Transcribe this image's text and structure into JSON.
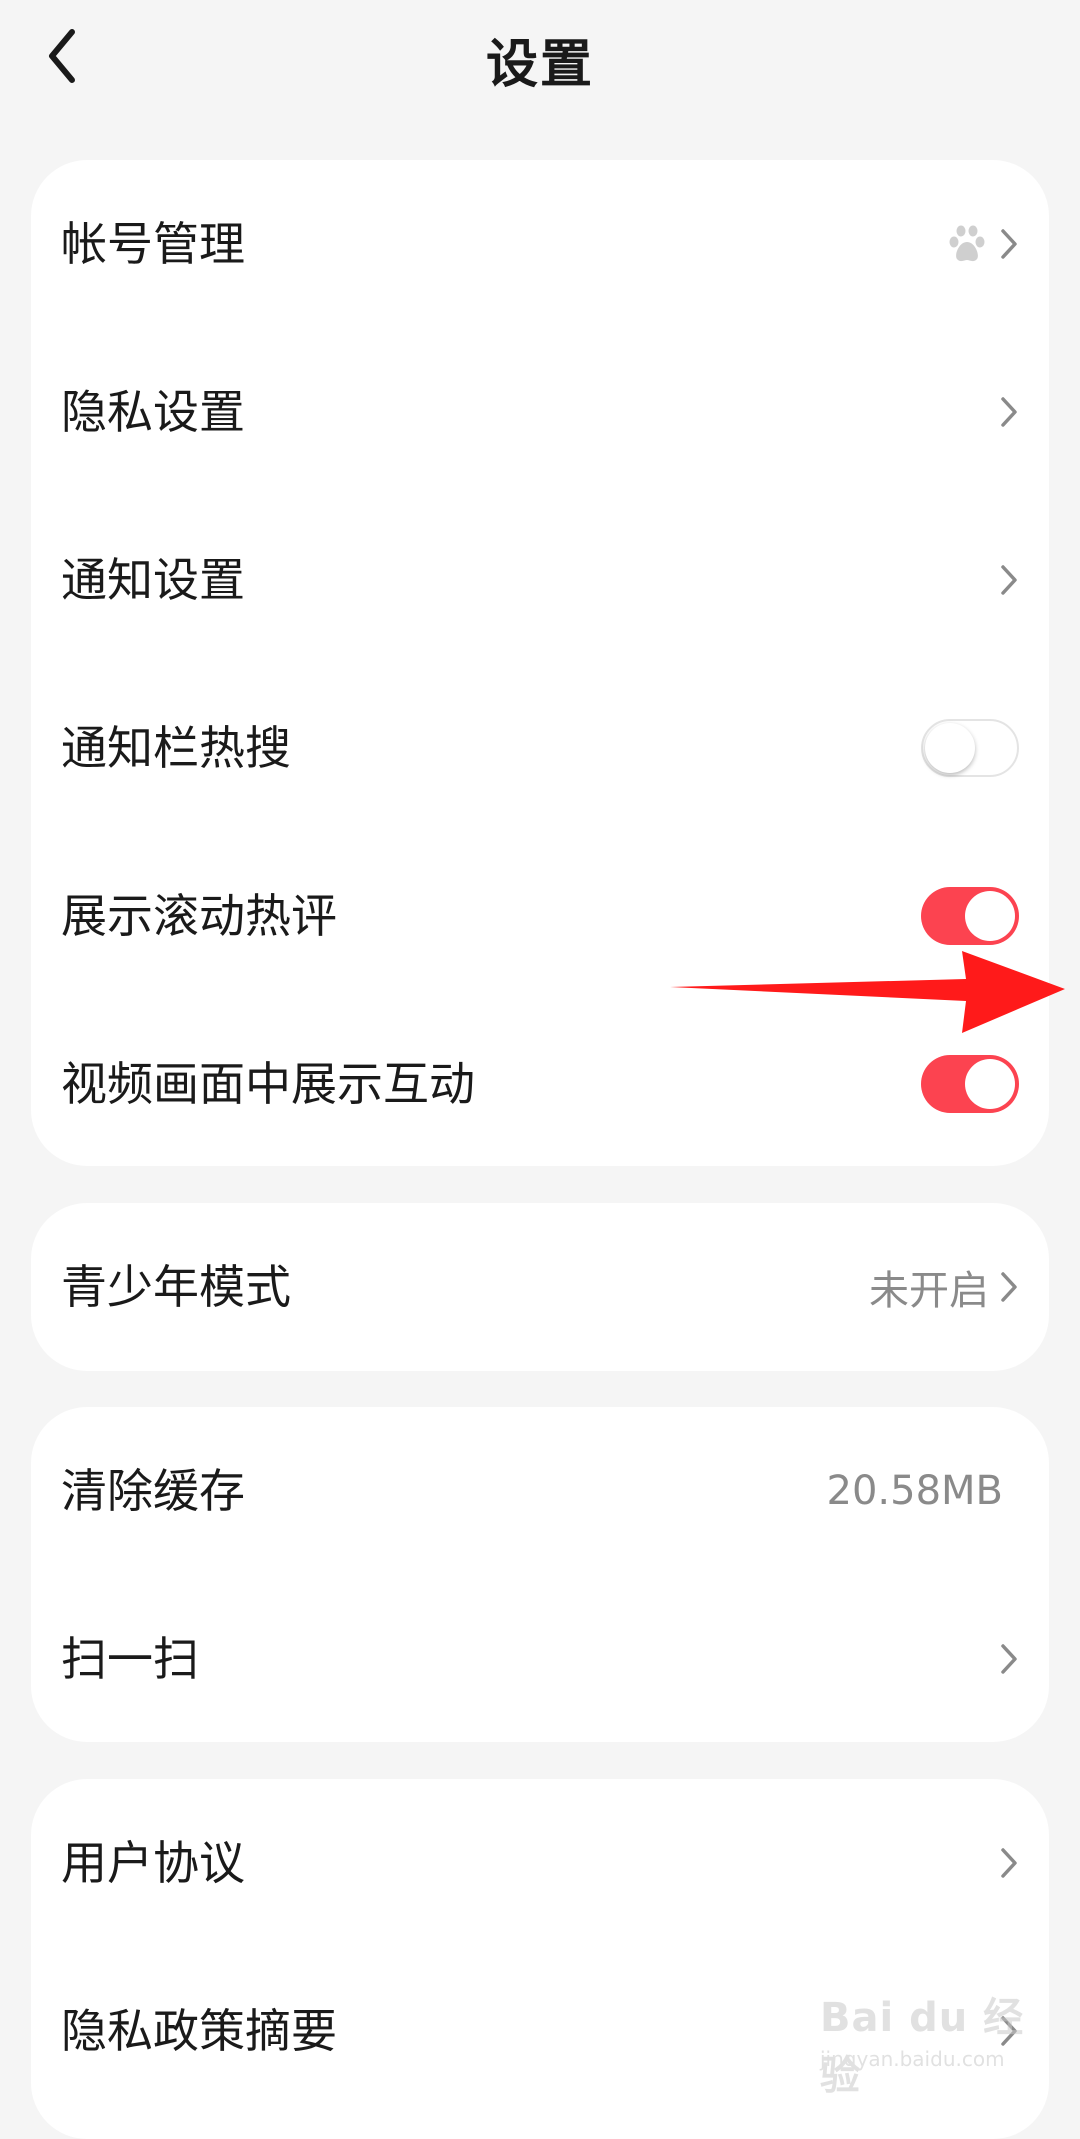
{
  "header": {
    "title": "设置"
  },
  "card1": {
    "items": [
      {
        "label": "帐号管理"
      },
      {
        "label": "隐私设置"
      },
      {
        "label": "通知设置"
      },
      {
        "label": "通知栏热搜",
        "toggle": false
      },
      {
        "label": "展示滚动热评",
        "toggle": true
      },
      {
        "label": "视频画面中展示互动",
        "toggle": true
      }
    ]
  },
  "card2": {
    "items": [
      {
        "label": "青少年模式",
        "value": "未开启"
      }
    ]
  },
  "card3": {
    "items": [
      {
        "label": "清除缓存",
        "value": "20.58MB"
      },
      {
        "label": "扫一扫"
      }
    ]
  },
  "card4": {
    "items": [
      {
        "label": "用户协议"
      },
      {
        "label": "隐私政策摘要"
      }
    ]
  },
  "watermark": {
    "logo": "Bai du 经验",
    "url": "jingyan.baidu.com"
  },
  "colors": {
    "accent": "#fc4350",
    "background": "#f5f5f5",
    "card": "#ffffff",
    "chevron": "#8a8a8a",
    "annotation_arrow": "#ff1a1a"
  },
  "icons": {
    "back": "chevron-left-icon",
    "account": "baidu-paw-icon",
    "row_nav": "chevron-right-icon"
  }
}
